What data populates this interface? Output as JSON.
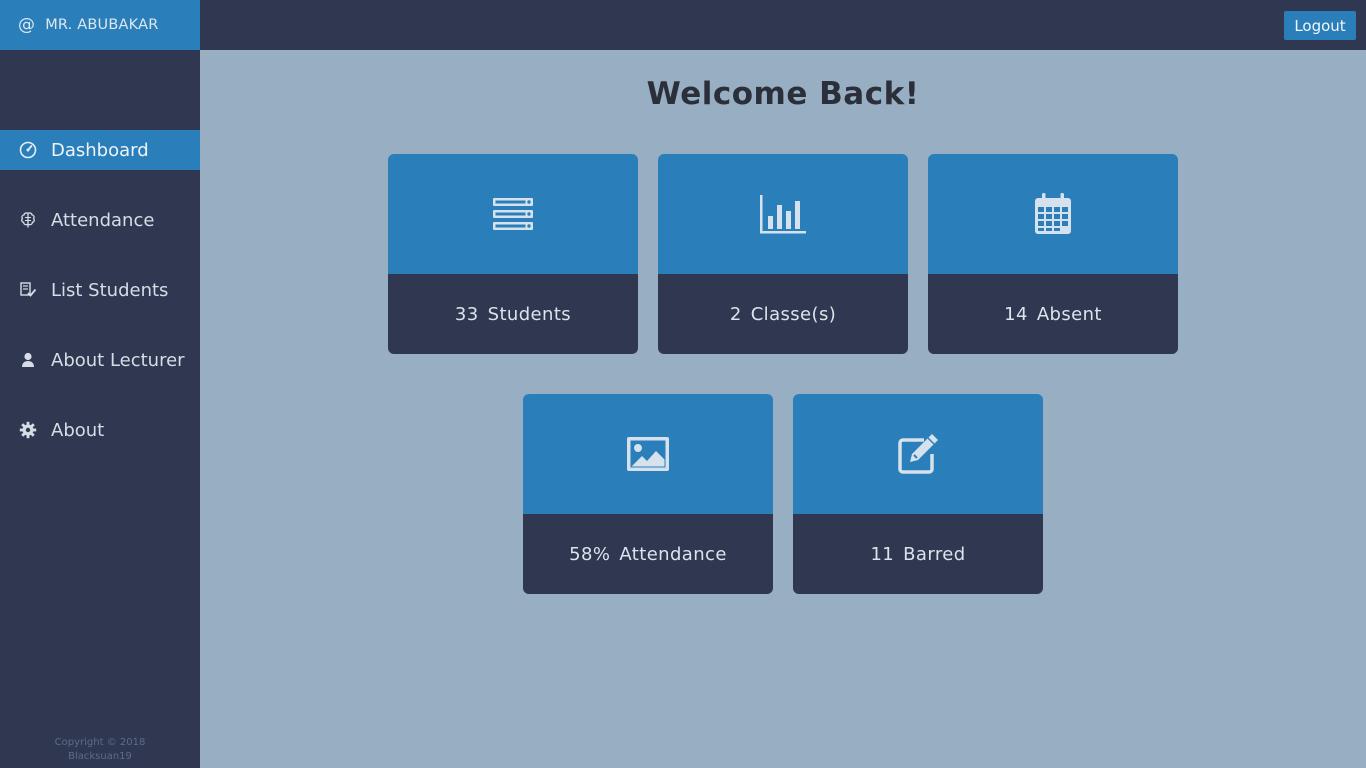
{
  "user": {
    "name": "MR. ABUBAKAR",
    "icon": "at-icon"
  },
  "header": {
    "logout_label": "Logout"
  },
  "sidebar": {
    "items": [
      {
        "label": "Dashboard",
        "icon": "dashboard-gauge-icon",
        "active": true
      },
      {
        "label": "Attendance",
        "icon": "brain-icon",
        "active": false
      },
      {
        "label": "List Students",
        "icon": "checklist-icon",
        "active": false
      },
      {
        "label": "About Lecturer",
        "icon": "user-icon",
        "active": false
      },
      {
        "label": "About",
        "icon": "gear-icon",
        "active": false
      }
    ],
    "copyright_line1": "Copyright © 2018",
    "copyright_line2": "Blacksuan19"
  },
  "main": {
    "title": "Welcome Back!",
    "cards": [
      {
        "value": "33",
        "label": "Students",
        "icon": "server-icon"
      },
      {
        "value": "2",
        "label": "Classe(s)",
        "icon": "bar-chart-icon"
      },
      {
        "value": "14",
        "label": "Absent",
        "icon": "calendar-icon"
      },
      {
        "value": "58%",
        "label": "Attendance",
        "icon": "image-icon"
      },
      {
        "value": "11",
        "label": "Barred",
        "icon": "edit-icon"
      }
    ]
  },
  "colors": {
    "accent": "#2a7fba",
    "sidebar_bg": "#2f3751",
    "page_bg": "#97aec3",
    "card_bottom": "#2f3751"
  }
}
